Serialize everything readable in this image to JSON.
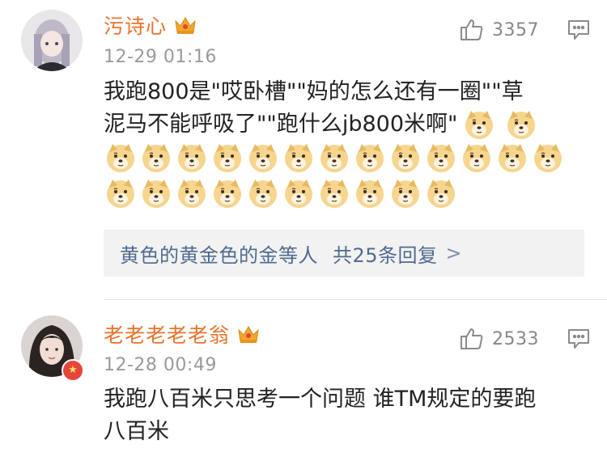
{
  "comments": [
    {
      "username": "污诗心",
      "timestamp": "12-29 01:16",
      "likes": "3357",
      "text_lines": [
        "我跑800是\"哎卧槽\"\"妈的怎么还有一圈\"\"草",
        "泥马不能呼吸了\"\"跑什么jb800米啊\""
      ],
      "doge_emoji_count": 24,
      "reply_preview": {
        "replier": "黄色的黄金色的金等人",
        "summary": "共25条回复",
        "chevron": ">"
      }
    },
    {
      "username": "老老老老老翁",
      "timestamp": "12-28 00:49",
      "likes": "2533",
      "text_lines": [
        "我跑八百米只思考一个问题 谁TM规定的要跑",
        "八百米"
      ]
    }
  ],
  "colors": {
    "username": "#e8732c",
    "reply_link": "#506a8f",
    "badge": "#e8443a",
    "crown": "#f2a72c"
  },
  "icons": [
    "crown-icon",
    "thumb-up-icon",
    "reply-icon",
    "doge-emoji",
    "verified-badge"
  ]
}
